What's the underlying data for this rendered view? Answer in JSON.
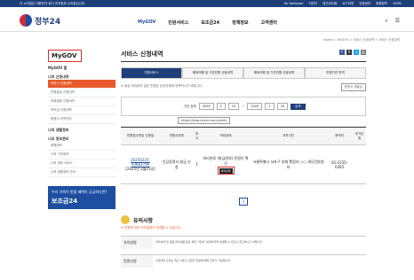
{
  "topbar": {
    "notice": "이 누리집은 대한민국 공식 전자정부 누리집입니다.",
    "links": [
      "for foreigner",
      "어린이",
      "접근성도움",
      "로그아웃",
      "인증센터",
      "회원정보",
      "100%"
    ]
  },
  "header": {
    "logo_text": "정부24",
    "nav": [
      "MyGOV",
      "민원서비스",
      "보조금24",
      "정책정보",
      "고객센터"
    ],
    "nav_active": 0
  },
  "breadcrumb": "Home > MyGOV > 서비스 신청내역 > 서비스 신청내역",
  "sidebar": {
    "title": "MyGOV",
    "home": "MyGOV 홈",
    "group1": "나의 신청내역",
    "items1": [
      "서비스 신청내역",
      "민원발급 신청내역",
      "조회열람 신청내역",
      "보조금 신청내역",
      "증명서 이력관리"
    ],
    "group2": "나의 생활정보",
    "group3": "나의 정보관리",
    "items3": [
      "회원정보",
      "나의 기관정보",
      "나의 계좌 서비스",
      "나의 생활정보 관리"
    ],
    "banner_top": "우리 가족이 받을 혜택이 궁금하다면?",
    "banner_big": "보조금24"
  },
  "content": {
    "title": "서비스 신청내역",
    "tabs": [
      "민원서비스",
      "해외여행 및 기관민원 신청내역",
      "해외여행 및 기관민원 신청내역",
      "민원기관 번역"
    ],
    "tab_active": 0,
    "note": "※ 정상 처리되지 않은 민원은 담당자에게 연락하시기 바랍니다.",
    "reissue_button": "증명서 재발급",
    "search_label": "- 기간 검색",
    "date_from": [
      "2025",
      "2",
      "25"
    ],
    "date_to": [
      "2025",
      "2",
      "25"
    ],
    "search_button": "검색",
    "url_overlay": "https://blog.naver.com/yeelty",
    "table_headers": [
      "민원접수번호 신청일",
      "민원사무명",
      "부수",
      "처리상태",
      "교부기관",
      "문의처",
      "추가신청"
    ],
    "rows": [
      {
        "receipt": "20250225-43682796",
        "date": "[2025년 2월25일]",
        "name": "인감증명서 발급 신청",
        "count": "1",
        "status": "처리완료 (발급완료) 민원인 확인",
        "detail": "처리내역",
        "agency": "서울특별시 서초구 양재 행정과 ○○ 세무민원센터",
        "phone": "02-2155-6305",
        "extra": ""
      }
    ],
    "page": "1"
  },
  "notes": {
    "title": "유의사항",
    "subtitle": "※ 민원에 따라 처리일정이 변경될 수 있습니다.",
    "rows": [
      {
        "key": "유의설명",
        "val": "처리상태 및 민원 처리내용 등은 해당 기관의 사정에 따라 변경될 수 있으니 참고하시기 바랍니다."
      },
      {
        "key": "민원신청",
        "val": "신청내역 조회는 최근 3년간 신청한 민원에 대해 조회가 가능합니다."
      }
    ]
  },
  "colors": {
    "primary": "#1d3f7a",
    "accent": "#e85a2a",
    "highlight": "#d32f2f"
  }
}
